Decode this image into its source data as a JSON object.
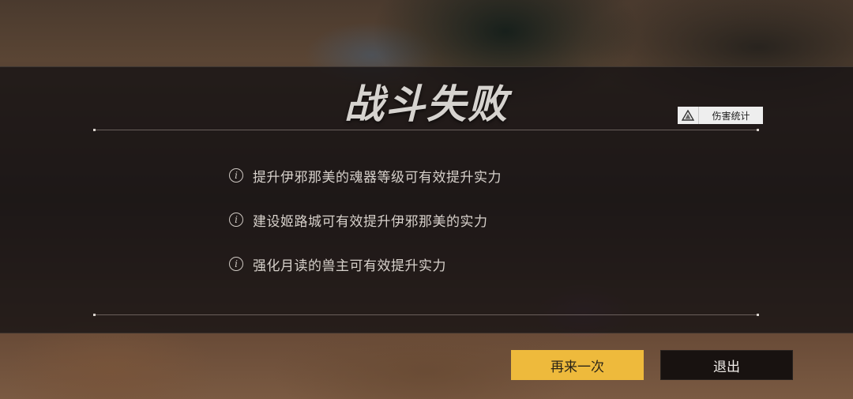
{
  "title": "战斗失败",
  "damage_stats": {
    "icon": "warning-triangle-icon",
    "label": "伤害统计"
  },
  "tips": [
    {
      "icon": "info-icon",
      "glyph": "i",
      "text": "提升伊邪那美的魂器等级可有效提升实力"
    },
    {
      "icon": "info-icon",
      "glyph": "i",
      "text": "建设姬路城可有效提升伊邪那美的实力"
    },
    {
      "icon": "info-icon",
      "glyph": "i",
      "text": "强化月读的兽主可有效提升实力"
    }
  ],
  "buttons": {
    "retry": "再来一次",
    "exit": "退出"
  },
  "colors": {
    "retry_bg": "#eeba3c",
    "exit_bg": "#181210",
    "overlay": "#161314"
  }
}
